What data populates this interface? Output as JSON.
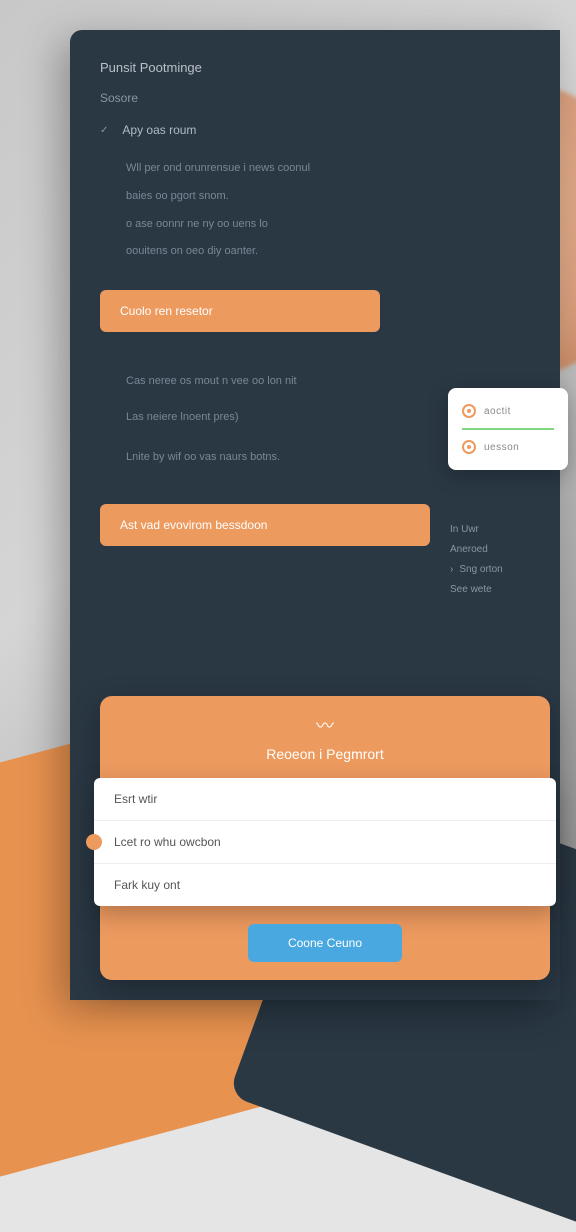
{
  "panel": {
    "title": "Punsit Pootminge",
    "subtitle": "Sosore",
    "check_item": "Apy oas roum",
    "paragraphs": [
      "Wll per ond orunrensue i news coonul",
      "baies oo pgort snom.",
      "o ase oonnr ne ny oo uens lo",
      "oouitens on oeo diy oanter."
    ],
    "btn1": "Cuolo ren resetor",
    "mid_text1": "Cas neree os mout n vee oo lon nit",
    "mid_text2": "Las neiere lnoent pres)",
    "mid_text3": "Lnite by wif oo vas naurs botns.",
    "btn2": "Ast vad evovirom bessdoon"
  },
  "widget": {
    "item1": "aoctit",
    "item2": "uesson"
  },
  "sidelist": {
    "items": [
      "In Uwr",
      "Aneroed",
      "Sng orton",
      "See wete"
    ]
  },
  "card": {
    "title": "Reoeon i Pegmrort",
    "options": [
      "Esrt wtir",
      "Lcet ro whu owcbon",
      "Fark kuy ont"
    ],
    "submit": "Coone Ceuno"
  }
}
